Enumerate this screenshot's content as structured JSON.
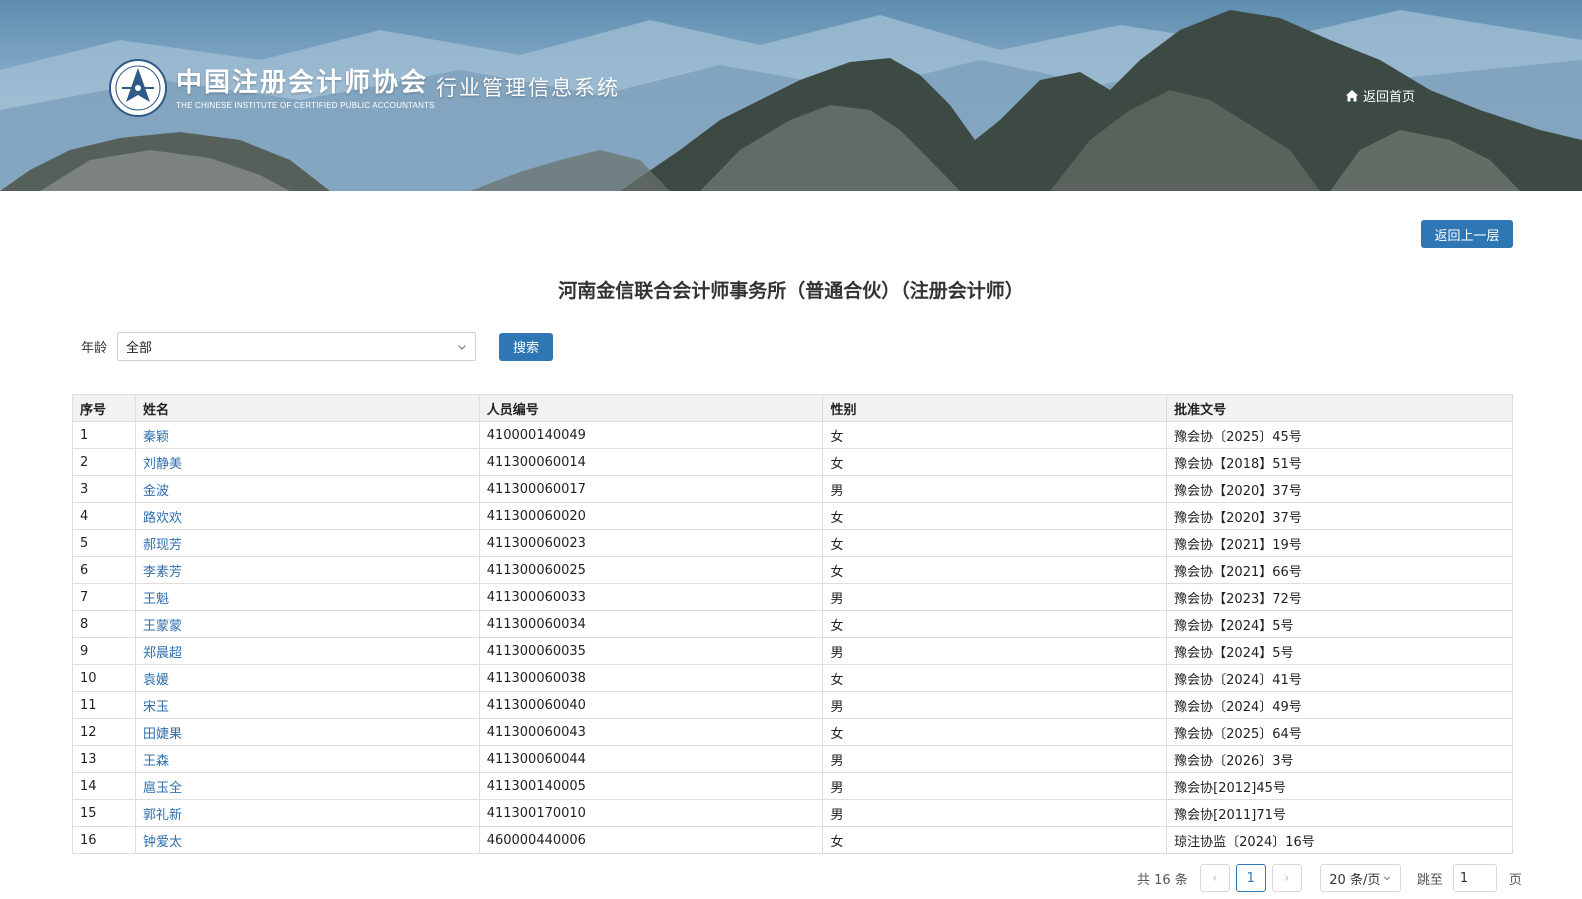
{
  "header": {
    "org_name_cn": "中国注册会计师协会",
    "org_name_en": "THE CHINESE INSTITUTE OF CERTIFIED PUBLIC ACCOUNTANTS",
    "system_name": "行业管理信息系统",
    "home_link": "返回首页",
    "home_icon": "home-icon"
  },
  "toolbar": {
    "back_label": "返回上一层"
  },
  "page": {
    "title": "河南金信联合会计师事务所（普通合伙）（注册会计师）"
  },
  "filter": {
    "label": "年龄",
    "selected": "全部",
    "search_label": "搜索"
  },
  "table": {
    "headers": [
      "序号",
      "姓名",
      "人员编号",
      "性别",
      "批准文号"
    ],
    "rows": [
      [
        "1",
        "秦颖",
        "410000140049",
        "女",
        "豫会协〔2025〕45号"
      ],
      [
        "2",
        "刘静美",
        "411300060014",
        "女",
        "豫会协【2018】51号"
      ],
      [
        "3",
        "金波",
        "411300060017",
        "男",
        "豫会协【2020】37号"
      ],
      [
        "4",
        "路欢欢",
        "411300060020",
        "女",
        "豫会协【2020】37号"
      ],
      [
        "5",
        "郝现芳",
        "411300060023",
        "女",
        "豫会协【2021】19号"
      ],
      [
        "6",
        "李素芳",
        "411300060025",
        "女",
        "豫会协【2021】66号"
      ],
      [
        "7",
        "王魁",
        "411300060033",
        "男",
        "豫会协【2023】72号"
      ],
      [
        "8",
        "王蒙蒙",
        "411300060034",
        "女",
        "豫会协【2024】5号"
      ],
      [
        "9",
        "郑晨超",
        "411300060035",
        "男",
        "豫会协【2024】5号"
      ],
      [
        "10",
        "袁媛",
        "411300060038",
        "女",
        "豫会协〔2024〕41号"
      ],
      [
        "11",
        "宋玉",
        "411300060040",
        "男",
        "豫会协〔2024〕49号"
      ],
      [
        "12",
        "田婕果",
        "411300060043",
        "女",
        "豫会协〔2025〕64号"
      ],
      [
        "13",
        "王森",
        "411300060044",
        "男",
        "豫会协〔2026〕3号"
      ],
      [
        "14",
        "扈玉全",
        "411300140005",
        "男",
        "豫会协[2012]45号"
      ],
      [
        "15",
        "郭礼新",
        "411300170010",
        "男",
        "豫会协[2011]71号"
      ],
      [
        "16",
        "钟爱太",
        "460000440006",
        "女",
        "琼注协监〔2024〕16号"
      ]
    ]
  },
  "pager": {
    "total": "共 16 条",
    "prev": "‹",
    "current": "1",
    "next": "›",
    "page_size": "20 条/页",
    "jump_label": "跳至",
    "jump_value": "1",
    "page_unit": "页"
  },
  "colors": {
    "primary": "#2f76b5",
    "link": "#2f6fae"
  }
}
